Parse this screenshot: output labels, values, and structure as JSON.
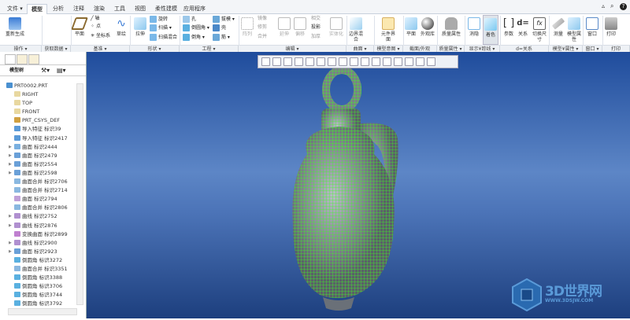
{
  "tabs": [
    {
      "label": "文件 ▾"
    },
    {
      "label": "模型"
    },
    {
      "label": "分析"
    },
    {
      "label": "注释"
    },
    {
      "label": "渲染"
    },
    {
      "label": "工具"
    },
    {
      "label": "视图"
    },
    {
      "label": "柔性建模"
    },
    {
      "label": "应用程序"
    }
  ],
  "ribbon": {
    "regenerate": "重新生成",
    "plane": "平面",
    "axis": "轴",
    "point": "点",
    "csys": "坐标系",
    "sketch": "草绘",
    "extrude": "拉伸",
    "revolve": "旋转",
    "sweep": "扫描",
    "swept_blend": "扫描混合",
    "hole": "孔",
    "round": "倒圆角",
    "chamfer": "倒角",
    "draft": "拔模",
    "shell": "壳",
    "rib": "筋",
    "pattern": "阵列",
    "mirror": "镜像",
    "trim": "修剪",
    "merge": "合并",
    "extend": "延伸",
    "offset": "偏移",
    "intersect": "相交",
    "project": "投影",
    "thicken": "加厚",
    "solidify": "实体化",
    "boundary_blend": "边界混合",
    "component_interface": "元件界面",
    "section_plane": "平面",
    "appearance": "外观库",
    "mass_props": "质量属性",
    "wireframe": "消隐",
    "shading": "着色",
    "params": "参数",
    "relations": "关系",
    "switch_dims": "切换尺寸",
    "measure": "测量",
    "model_props": "模型属性",
    "window": "窗口",
    "print": "打印"
  },
  "groups": [
    "操作 ▾",
    "获取数据 ▾",
    "基准 ▾",
    "形状 ▾",
    "工程 ▾",
    "编辑 ▾",
    "曲面 ▾",
    "模型意图 ▾",
    "截面/外观",
    "质量属性 ▾",
    "显示¥踪线 ▾",
    "d=关系",
    "模型¥属性 ▾",
    "窗口 ▾",
    "打印"
  ],
  "panel": {
    "title": "模型树"
  },
  "tree": [
    {
      "label": "PRT0002.PRT",
      "color": "#4a90d0",
      "exp": ""
    },
    {
      "label": "RIGHT",
      "color": "#e8d8a0",
      "exp": "",
      "indent": 1
    },
    {
      "label": "TOP",
      "color": "#e8d8a0",
      "exp": "",
      "indent": 1
    },
    {
      "label": "FRONT",
      "color": "#e8d8a0",
      "exp": "",
      "indent": 1
    },
    {
      "label": "PRT_CSYS_DEF",
      "color": "#d0a040",
      "exp": "",
      "indent": 1
    },
    {
      "label": "导入特征 标识39",
      "color": "#5a9ad8",
      "exp": "",
      "indent": 1
    },
    {
      "label": "导入特征 标识2417",
      "color": "#5a9ad8",
      "exp": "",
      "indent": 1
    },
    {
      "label": "曲面 标识2444",
      "color": "#7ab0e0",
      "exp": "▶",
      "indent": 1
    },
    {
      "label": "曲面 标识2479",
      "color": "#6aa0d8",
      "exp": "▶",
      "indent": 1
    },
    {
      "label": "曲面 标识2554",
      "color": "#6aa0d8",
      "exp": "▶",
      "indent": 1
    },
    {
      "label": "曲面 标识2598",
      "color": "#6aa0d8",
      "exp": "▶",
      "indent": 1
    },
    {
      "label": "曲面合并 标识2706",
      "color": "#8ab8e0",
      "exp": "",
      "indent": 1
    },
    {
      "label": "曲面合并 标识2714",
      "color": "#8ab8e0",
      "exp": "",
      "indent": 1
    },
    {
      "label": "曲面 标识2794",
      "color": "#c0a0d8",
      "exp": "",
      "indent": 1
    },
    {
      "label": "曲面合并 标识2806",
      "color": "#8ab8e0",
      "exp": "",
      "indent": 1
    },
    {
      "label": "曲线 标识2752",
      "color": "#b090d0",
      "exp": "▶",
      "indent": 1
    },
    {
      "label": "曲线 标识2876",
      "color": "#b090d0",
      "exp": "▶",
      "indent": 1
    },
    {
      "label": "变换曲面 标识2899",
      "color": "#c080d0",
      "exp": "",
      "indent": 1
    },
    {
      "label": "曲线 标识2900",
      "color": "#b090d0",
      "exp": "▶",
      "indent": 1
    },
    {
      "label": "曲面 标识2923",
      "color": "#6aa0d8",
      "exp": "▶",
      "indent": 1
    },
    {
      "label": "倒圆角 标识3272",
      "color": "#5ab0e0",
      "exp": "",
      "indent": 1
    },
    {
      "label": "曲面合并 标识3351",
      "color": "#8ab8e0",
      "exp": "",
      "indent": 1
    },
    {
      "label": "倒圆角 标识3388",
      "color": "#5ab0e0",
      "exp": "",
      "indent": 1
    },
    {
      "label": "倒圆角 标识3706",
      "color": "#5ab0e0",
      "exp": "",
      "indent": 1
    },
    {
      "label": "倒圆角 标识3744",
      "color": "#5ab0e0",
      "exp": "",
      "indent": 1
    },
    {
      "label": "倒圆角 标识3792",
      "color": "#5ab0e0",
      "exp": "",
      "indent": 1
    }
  ],
  "watermark": {
    "name": "3D世界网",
    "url": "WWW.3DSJW.COM"
  },
  "colors": {
    "mesh": "#3cff20",
    "body": "#8a9098",
    "accent": "#3a7bd5"
  }
}
